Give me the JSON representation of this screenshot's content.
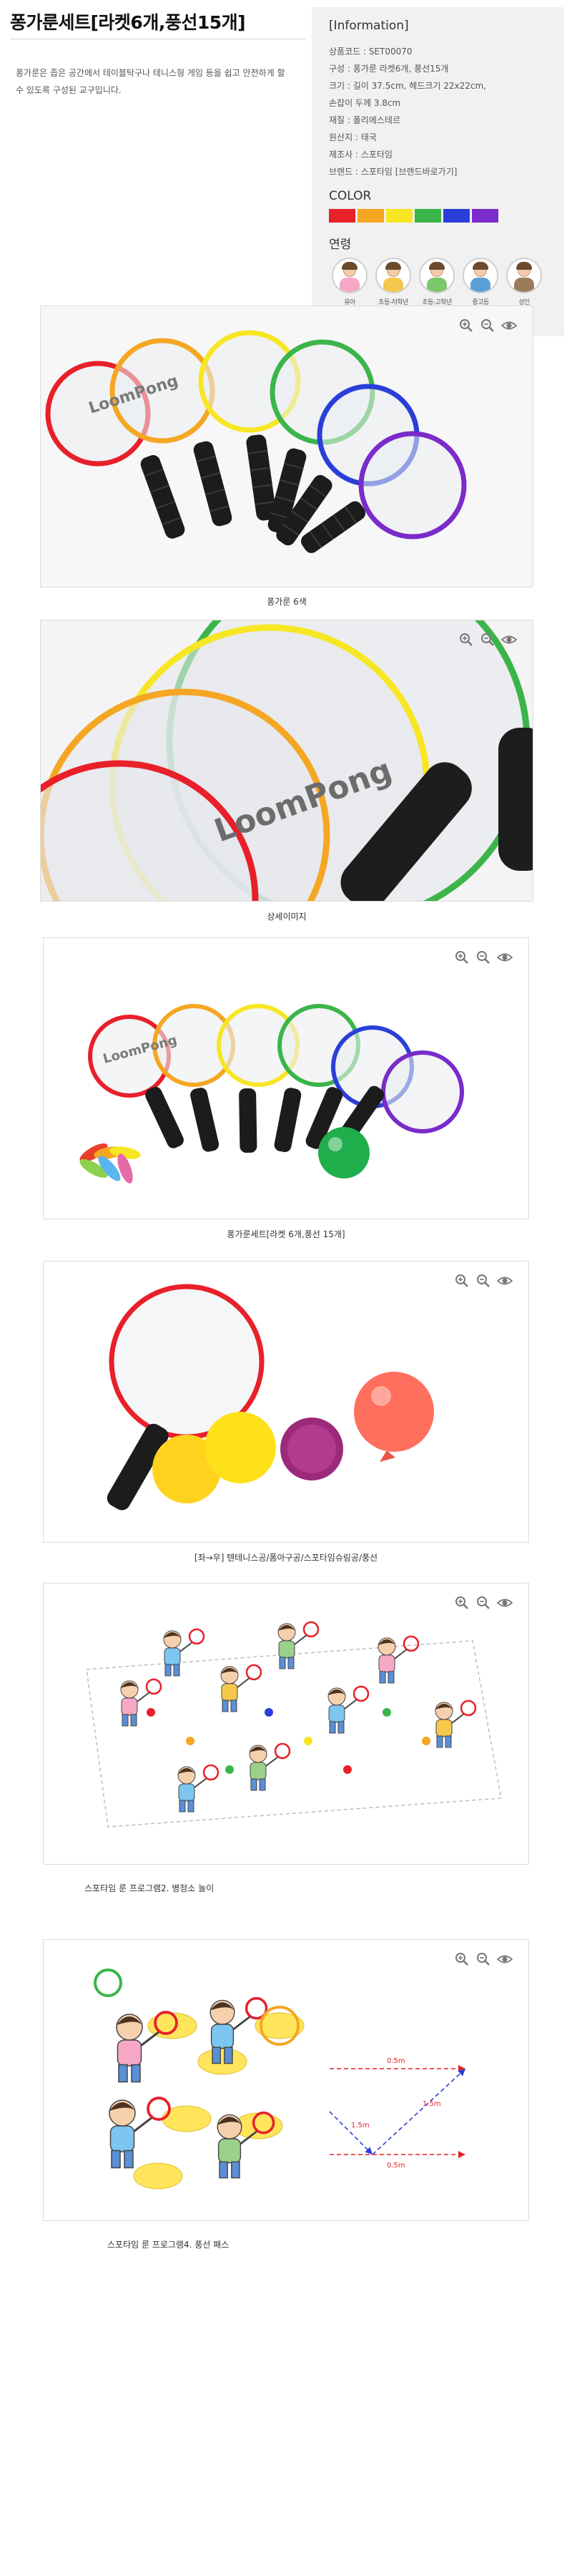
{
  "title": "퐁가룬세트[라켓6개,풍선15개]",
  "description": "퐁가룬은 좁은 공간에서 테이블탁구나 테니스형  게임 등을 쉽고 안전하게 할 수 있도록 구성된 교구입니다.",
  "info": {
    "heading": "[Information]",
    "rows": [
      "상품코드 : SET00070",
      "구성 : 퐁가룬 라켓6개, 풍선15개",
      "크기 : 길이 37.5cm, 헤드크기 22x22cm,",
      "손잡이 두께 3.8cm",
      "재질 : 폴리에스테르",
      "원산지 : 태국",
      "제조사 : 스포타임",
      "브랜드 : 스포타임 [브랜드바로가기]"
    ],
    "color_heading": "COLOR",
    "colors": [
      "#e8202a",
      "#f5a623",
      "#f7e623",
      "#3bb54a",
      "#2a3fd8",
      "#7a2bc9"
    ],
    "age_heading": "연령",
    "ages": [
      {
        "label": "유아",
        "shirt": "#f7a8c6"
      },
      {
        "label": "초등-저학년",
        "shirt": "#f5c84c"
      },
      {
        "label": "초등-고학년",
        "shirt": "#7cc66b"
      },
      {
        "label": "중고등",
        "shirt": "#5aa0d8"
      },
      {
        "label": "성인",
        "shirt": "#9a7b5a"
      }
    ]
  },
  "captions": [
    "퐁가룬 6색",
    "상세이미지",
    "퐁가룬세트[라켓 6개,풍선 15개]",
    "[좌→우] 텐테니스공/폼아구공/스포타임슈링공/풍선",
    "스포타임 룬 프로그램2. 병정소 놀이",
    "스포타임 룬 프로그램4. 풍선 패스"
  ],
  "diagram_labels": {
    "arrow_a": "0.5m",
    "arrow_b": "0.5m",
    "arrow_c": "1.5m",
    "arrow_d": "1.5m"
  },
  "racket_brand": "LoomPong"
}
